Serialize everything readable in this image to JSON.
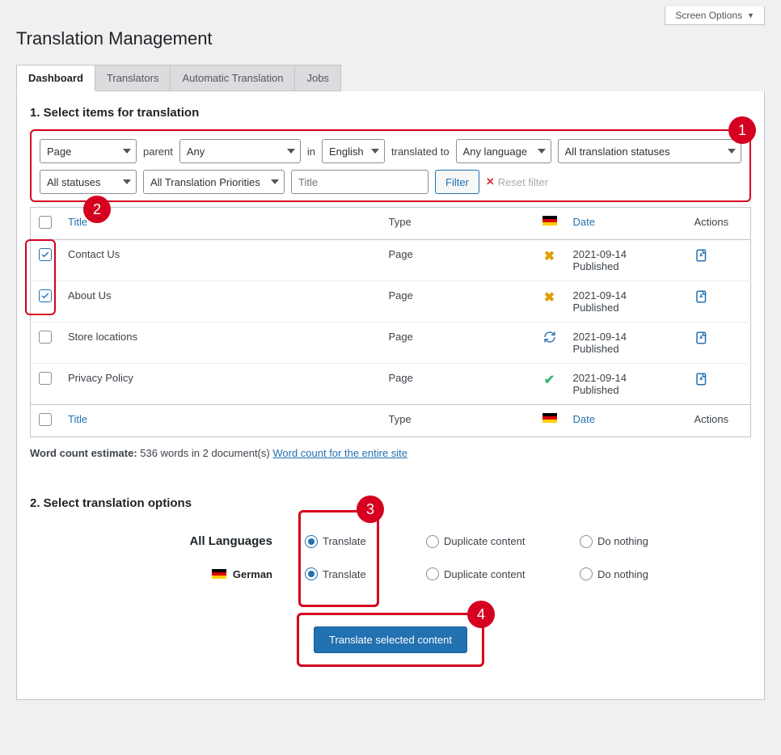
{
  "screen_options": "Screen Options",
  "page_title": "Translation Management",
  "tabs": [
    "Dashboard",
    "Translators",
    "Automatic Translation",
    "Jobs"
  ],
  "active_tab": 0,
  "section1_title": "1. Select items for translation",
  "filters": {
    "post_type": "Page",
    "parent_label": "parent",
    "parent_value": "Any",
    "in_label": "in",
    "language": "English",
    "translated_to_label": "translated to",
    "translated_to": "Any language",
    "translation_status": "All translation statuses",
    "publish_status": "All statuses",
    "priority": "All Translation Priorities",
    "title_placeholder": "Title",
    "filter_btn": "Filter",
    "reset_btn": "Reset filter"
  },
  "table": {
    "columns": {
      "title": "Title",
      "type": "Type",
      "date": "Date",
      "actions": "Actions"
    },
    "rows": [
      {
        "checked": true,
        "title": "Contact Us",
        "type": "Page",
        "status": "not",
        "date": "2021-09-14",
        "date2": "Published"
      },
      {
        "checked": true,
        "title": "About Us",
        "type": "Page",
        "status": "not",
        "date": "2021-09-14",
        "date2": "Published"
      },
      {
        "checked": false,
        "title": "Store locations",
        "type": "Page",
        "status": "update",
        "date": "2021-09-14",
        "date2": "Published"
      },
      {
        "checked": false,
        "title": "Privacy Policy",
        "type": "Page",
        "status": "done",
        "date": "2021-09-14",
        "date2": "Published"
      }
    ]
  },
  "word_count": {
    "label": "Word count estimate:",
    "text": "536 words in 2 document(s)",
    "link": "Word count for the entire site"
  },
  "section2_title": "2. Select translation options",
  "options": {
    "col_translate": "Translate",
    "col_duplicate": "Duplicate content",
    "col_nothing": "Do nothing",
    "rows": [
      {
        "label": "All Languages",
        "flag": false,
        "selected": "translate"
      },
      {
        "label": "German",
        "flag": true,
        "selected": "translate"
      }
    ]
  },
  "primary_btn": "Translate selected content",
  "callouts": {
    "c1": "1",
    "c2": "2",
    "c3": "3",
    "c4": "4"
  }
}
